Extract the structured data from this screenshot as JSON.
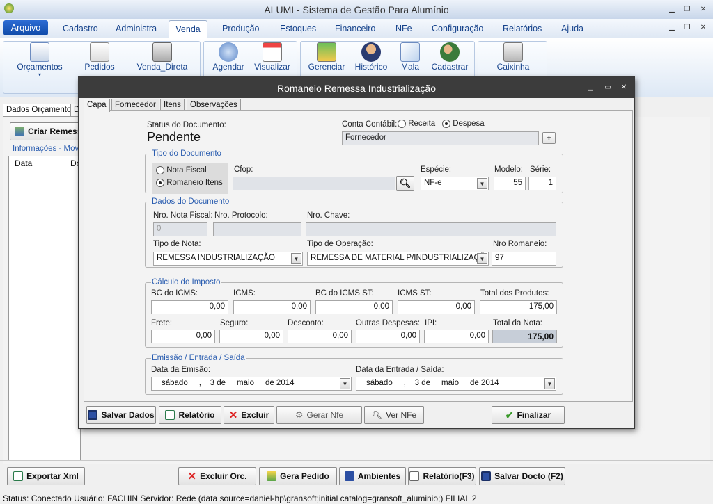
{
  "app": {
    "title": "ALUMI - Sistema de Gestão Para Alumínio"
  },
  "menu": {
    "arquivo": "Arquivo",
    "items": [
      "Cadastro",
      "Administra",
      "Venda",
      "Produção",
      "Estoques",
      "Financeiro",
      "NFe",
      "Configuração",
      "Relatórios",
      "Ajuda"
    ]
  },
  "ribbon": {
    "orcamentos": "Orçamentos",
    "pedidos": "Pedidos",
    "venda_direta": "Venda_Direta",
    "agendar": "Agendar",
    "visualizar": "Visualizar",
    "gerenciar": "Gerenciar",
    "historico": "Histórico",
    "mala": "Mala",
    "cadastrar": "Cadastrar",
    "caixinha": "Caixinha"
  },
  "background": {
    "tab_dados": "Dados Orçamento",
    "tab_d": "D",
    "criar_remessa": "Criar Remess",
    "info_label": "Informações - Movin",
    "col_data": "Data",
    "col_do": "Do"
  },
  "dialog": {
    "title": "Romaneio Remessa Industrialização",
    "tabs": [
      "Capa",
      "Fornecedor",
      "Itens",
      "Observações"
    ],
    "status_label": "Status do Documento:",
    "status_value": "Pendente",
    "conta_label": "Conta Contábil:",
    "receita": "Receita",
    "despesa": "Despesa",
    "fornecedor_value": "Fornecedor",
    "plus": "+",
    "tipo_doc": {
      "legend": "Tipo do Documento",
      "nota_fiscal": "Nota Fiscal",
      "romaneio_itens": "Romaneio Itens",
      "cfop_label": "Cfop:",
      "cfop_value": "",
      "especie_label": "Espécie:",
      "especie_value": "NF-e",
      "modelo_label": "Modelo:",
      "modelo_value": "55",
      "serie_label": "Série:",
      "serie_value": "1"
    },
    "dados_doc": {
      "legend": "Dados do Documento",
      "nro_nf_label": "Nro. Nota Fiscal:",
      "nro_nf_value": "0",
      "protocolo_label": "Nro. Protocolo:",
      "chave_label": "Nro. Chave:",
      "tipo_nota_label": "Tipo de Nota:",
      "tipo_nota_value": "REMESSA INDUSTRIALIZAÇÃO",
      "tipo_op_label": "Tipo de Operação:",
      "tipo_op_value": "REMESSA DE MATERIAL P/INDUSTRIALIZAÇÃ",
      "romaneio_label": "Nro Romaneio:",
      "romaneio_value": "97"
    },
    "calculo": {
      "legend": "Cálculo do Imposto",
      "bc_icms_label": "BC do ICMS:",
      "bc_icms": "0,00",
      "icms_label": "ICMS:",
      "icms": "0,00",
      "bc_st_label": "BC do ICMS ST:",
      "bc_st": "0,00",
      "icms_st_label": "ICMS ST:",
      "icms_st": "0,00",
      "total_prod_label": "Total dos Produtos:",
      "total_prod": "175,00",
      "frete_label": "Frete:",
      "frete": "0,00",
      "seguro_label": "Seguro:",
      "seguro": "0,00",
      "desconto_label": "Desconto:",
      "desconto": "0,00",
      "outras_label": "Outras Despesas:",
      "outras": "0,00",
      "ipi_label": "IPI:",
      "ipi": "0,00",
      "total_nota_label": "Total da Nota:",
      "total_nota": "175,00"
    },
    "emissao": {
      "legend": "Emissão / Entrada / Saída",
      "emissao_label": "Data da Emisão:",
      "emissao_value": "sábado     ,    3 de     maio     de 2014",
      "entrada_label": "Data da Entrada / Saída:",
      "entrada_value": "sábado     ,    3 de     maio     de 2014"
    },
    "buttons": {
      "salvar": "Salvar Dados",
      "relatorio": "Relatório",
      "excluir": "Excluir",
      "gerar": "Gerar Nfe",
      "ver": "Ver NFe",
      "finalizar": "Finalizar"
    }
  },
  "bottom": {
    "exportar": "Exportar Xml",
    "excluir_orc": "Excluir Orc.",
    "gera_pedido": "Gera Pedido",
    "ambientes": "Ambientes",
    "relatorio_f3": "Relatório(F3)",
    "salvar_f2": "Salvar Docto (F2)"
  },
  "status": {
    "text": "Status: Conectado   Usuário: FACHIN  Servidor: Rede (data source=daniel-hp\\gransoft;initial catalog=gransoft_aluminio;)   FILIAL 2"
  }
}
